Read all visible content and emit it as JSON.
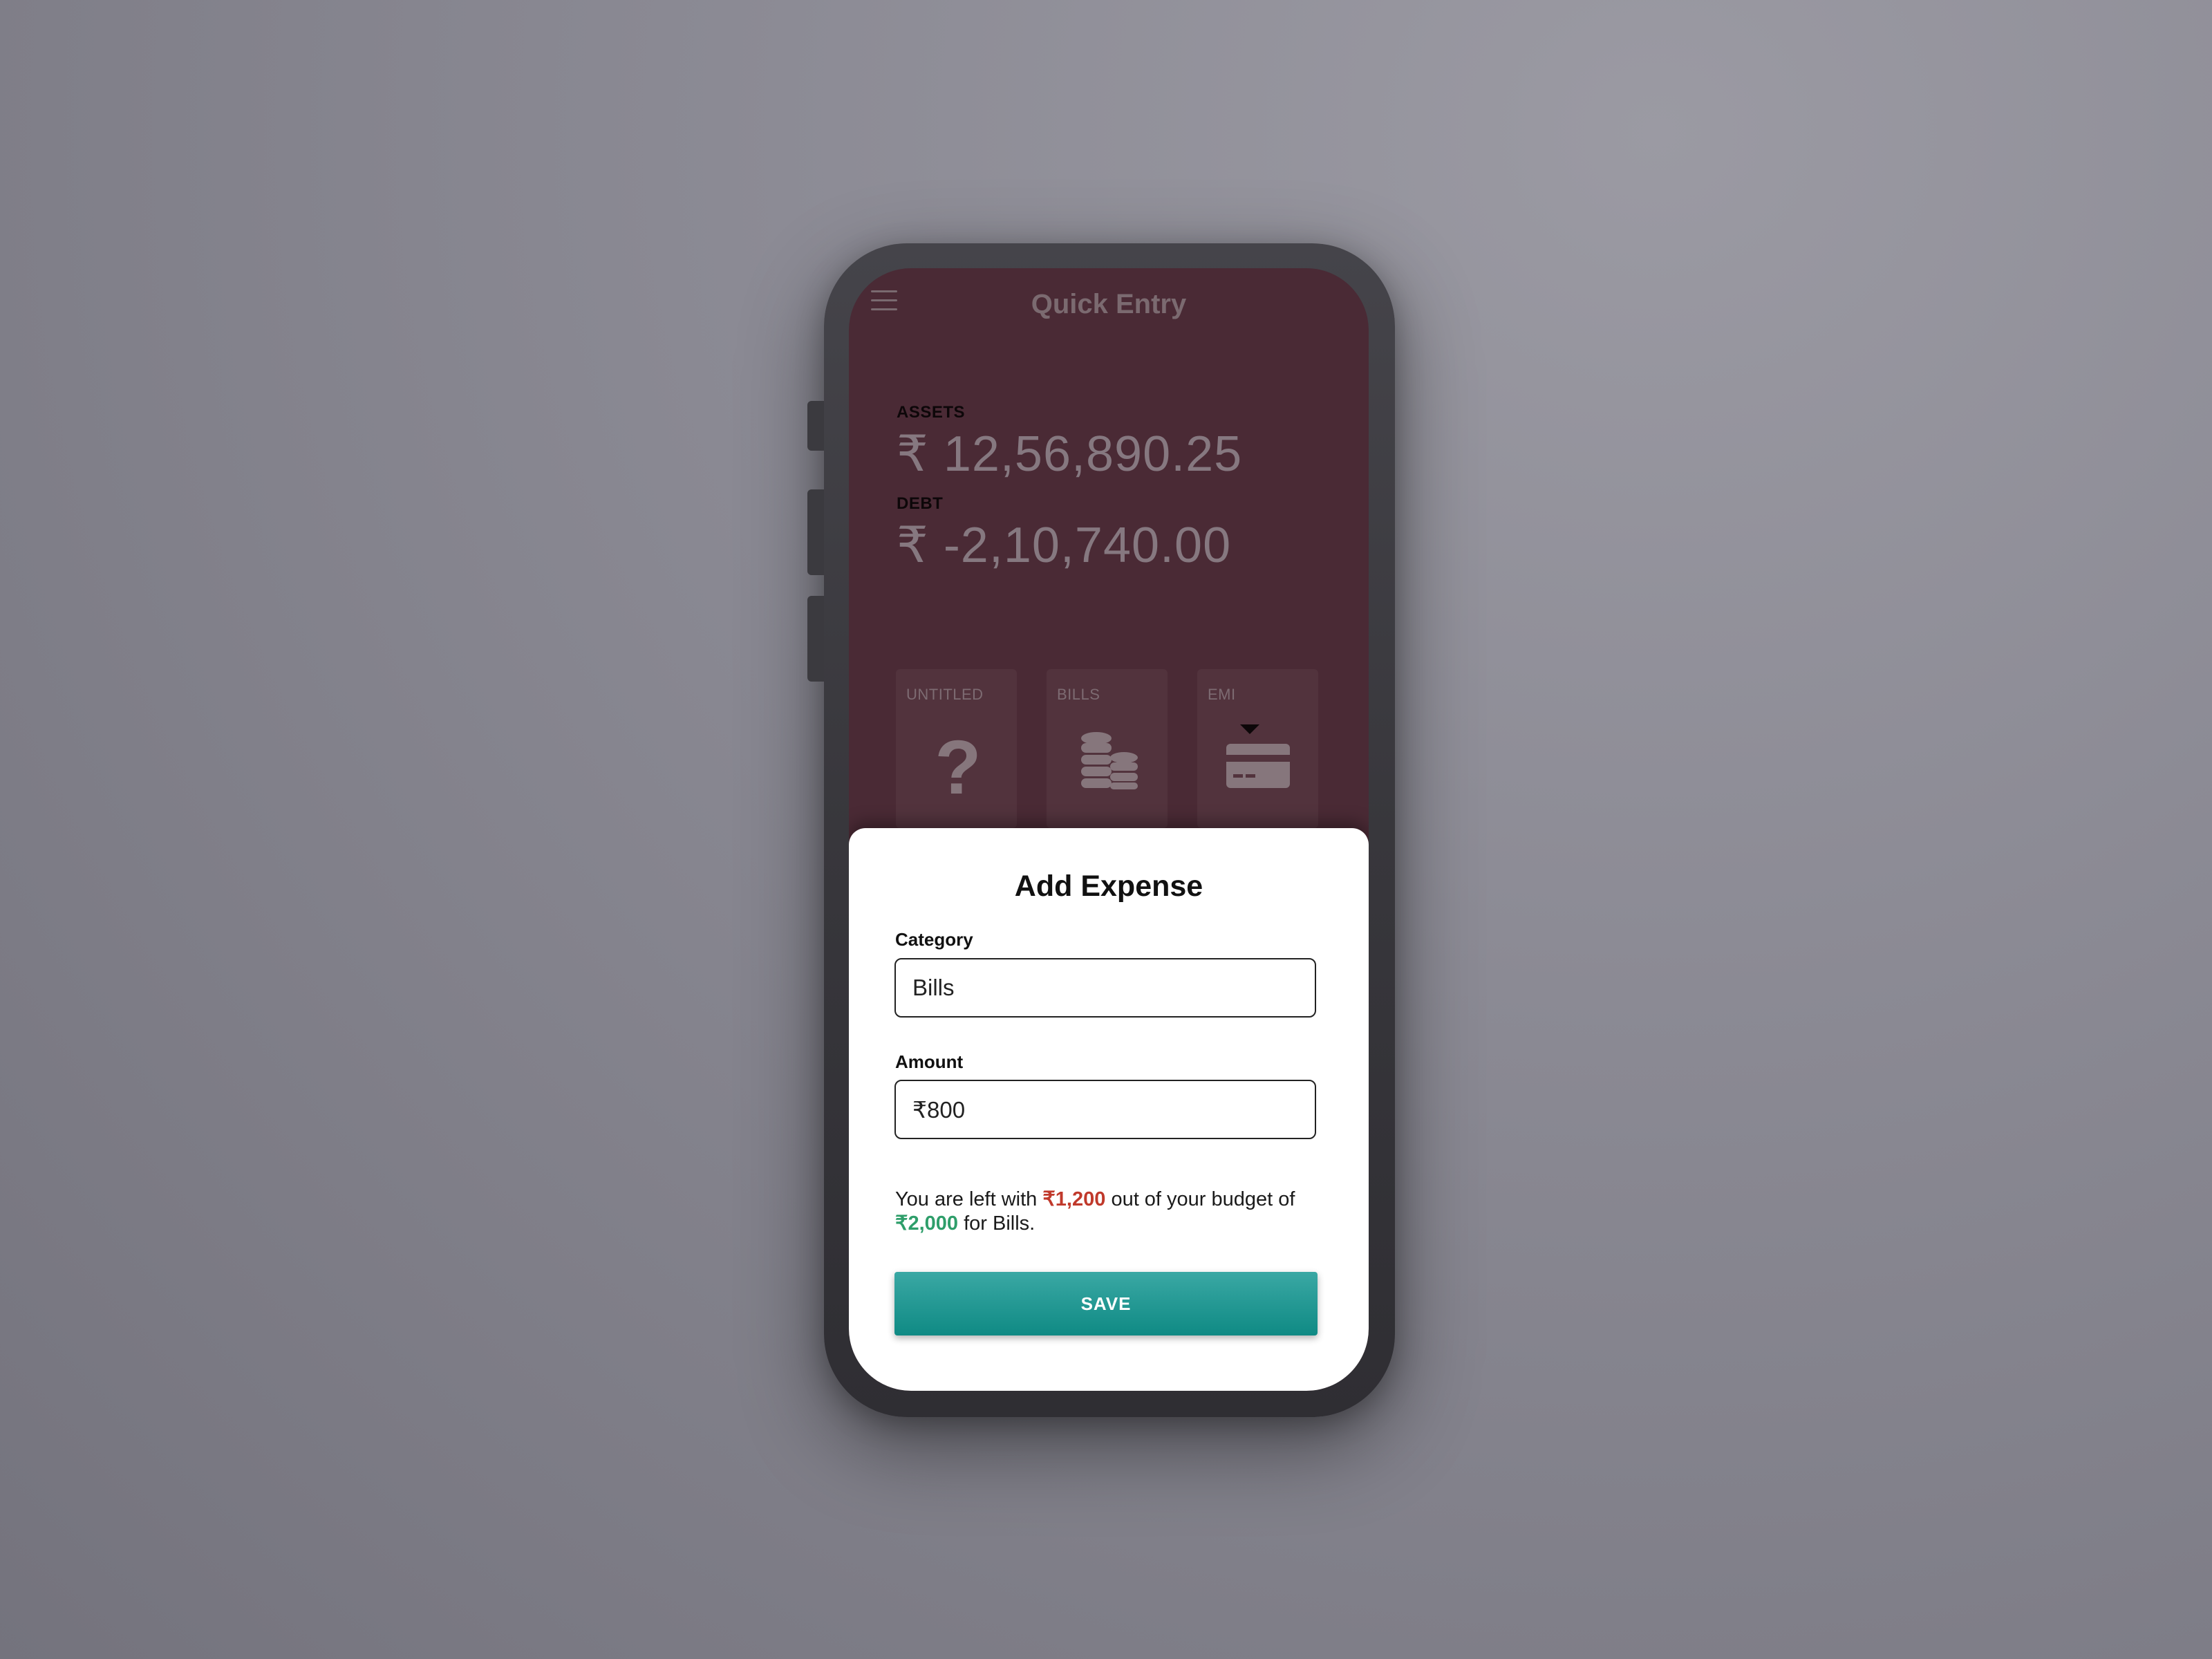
{
  "app": {
    "title": "Quick Entry"
  },
  "summary": {
    "assets_label": "ASSETS",
    "assets_value": "₹ 12,56,890.25",
    "debt_label": "DEBT",
    "debt_value": "₹ -2,10,740.00"
  },
  "categories": [
    {
      "label": "UNTITLED",
      "icon": "question-icon"
    },
    {
      "label": "BILLS",
      "icon": "coins-icon"
    },
    {
      "label": "EMI",
      "icon": "credit-card-icon"
    }
  ],
  "sheet": {
    "title": "Add Expense",
    "category_label": "Category",
    "category_value": "Bills",
    "amount_label": "Amount",
    "amount_value": "₹800",
    "message_prefix": "You are left with",
    "message_left": "₹1,200",
    "message_middle": "out of your budget of",
    "message_budget": "₹2,000",
    "message_suffix": "for Bills.",
    "save_label": "SAVE"
  },
  "colors": {
    "background_app": "#4a2a35",
    "amount_left": "#c0392b",
    "amount_budget": "#2e9e6a",
    "save_button": "#15918b"
  }
}
